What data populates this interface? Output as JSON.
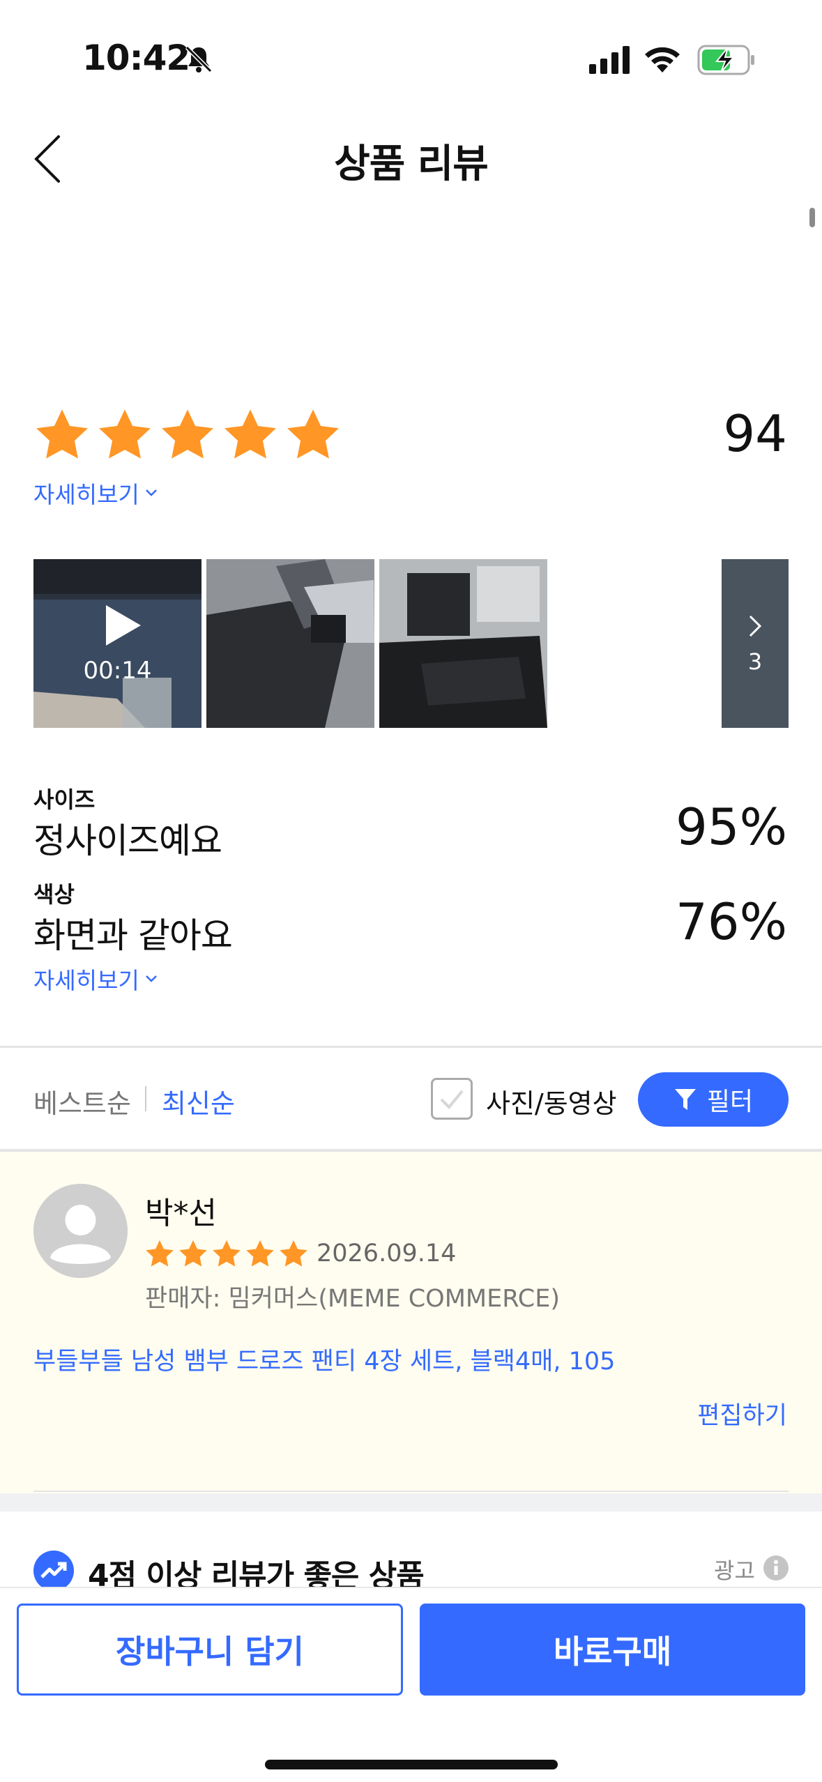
{
  "status_bar": {
    "time": "10:42"
  },
  "header": {
    "title": "상품 리뷰"
  },
  "summary": {
    "star_rating": 5,
    "review_count": "94",
    "detail_label": "자세히보기"
  },
  "media": {
    "video_duration": "00:14",
    "more_count": "3"
  },
  "survey": [
    {
      "question": "사이즈",
      "answer": "정사이즈예요",
      "percent": "95%"
    },
    {
      "question": "색상",
      "answer": "화면과 같아요",
      "percent": "76%"
    }
  ],
  "survey_detail_label": "자세히보기",
  "sort": {
    "best": "베스트순",
    "latest": "최신순",
    "photo_filter_label": "사진/동영상",
    "filter_button": "필터"
  },
  "review": {
    "name": "박*선",
    "stars": 5,
    "date": "2026.09.14",
    "seller": "판매자: 밈커머스(MEME COMMERCE)",
    "option": "부들부들 남성 뱀부 드로즈 팬티 4장 세트, 블랙4매, 105",
    "edit_label": "편집하기"
  },
  "recommendation": {
    "title": "4점 이상 리뷰가 좋은 상품",
    "ad_label": "광고"
  },
  "bottom_bar": {
    "cart_label": "장바구니 담기",
    "buy_label": "바로구매"
  },
  "colors": {
    "accent": "#346aff",
    "star": "#ff9625",
    "review_bg": "#fffdef"
  }
}
